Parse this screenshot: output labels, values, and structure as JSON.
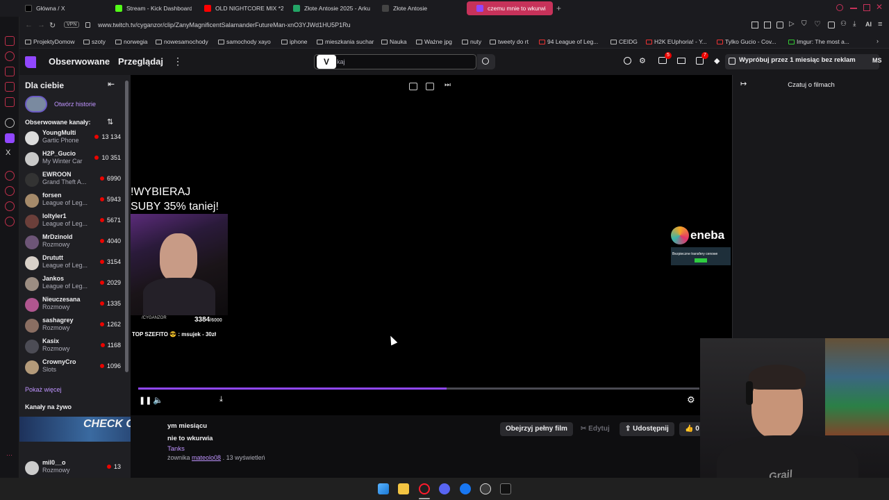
{
  "browser": {
    "tabs": [
      {
        "label": "Główna / X",
        "favicon": "x-icon",
        "active": false
      },
      {
        "label": "Stream - Kick Dashboard",
        "favicon": "kick-icon",
        "active": false
      },
      {
        "label": "OLD NIGHTCORE MIX *20",
        "favicon": "youtube-icon",
        "active": false
      },
      {
        "label": "Złote Antosie 2025 - Arku",
        "favicon": "sheets-icon",
        "active": false
      },
      {
        "label": "Złote Antosie",
        "favicon": "tab-icon",
        "active": false
      },
      {
        "label": "czemu mnie to wkurwi",
        "favicon": "twitch-icon",
        "active": true
      }
    ],
    "url": "www.twitch.tv/cyganzor/clip/ZanyMagnificentSalamanderFutureMan-xnO3YJWd1HU5P1Ru",
    "vpn_label": "VPN",
    "ai_label": "AI",
    "bookmarks": [
      "ProjektyDomow",
      "szoty",
      "norwegia",
      "nowesamochody",
      "samochody xayo",
      "iphone",
      "mieszkania suchar",
      "Nauka",
      "Ważne jpg",
      "nuty",
      "tweety do rt",
      "94 League of Leg...",
      "CEIDG",
      "H2K EUphoria! - Y...",
      "Tylko Gucio - Cov...",
      "Imgur: The most a..."
    ]
  },
  "twitch": {
    "nav": {
      "followed": "Obserwowane",
      "browse": "Przeglądaj",
      "search_placeholder": "kaj",
      "search_logo": "V",
      "promo": "Wypróbuj przez 1 miesiąc bez reklam",
      "avatar_initials": "MS",
      "badge_prime": "5",
      "badge_notif": "7"
    },
    "sidebar": {
      "title": "Dla ciebie",
      "stories": "Otwórz historie",
      "followed_header": "Obserwowane kanały:",
      "channels": [
        {
          "name": "YoungMulti",
          "game": "Gartic Phone",
          "viewers": "13 134",
          "color": "#dcdcdc"
        },
        {
          "name": "H2P_Gucio",
          "game": "My Winter Car",
          "viewers": "10 351",
          "color": "#c9c9c9"
        },
        {
          "name": "EWROON",
          "game": "Grand Theft A...",
          "viewers": "6990",
          "color": "#333333"
        },
        {
          "name": "forsen",
          "game": "League of Leg...",
          "viewers": "5943",
          "color": "#a58a6a"
        },
        {
          "name": "loltyler1",
          "game": "League of Leg...",
          "viewers": "5671",
          "color": "#6b3f3a"
        },
        {
          "name": "MrDzinold",
          "game": "Rozmowy",
          "viewers": "4040",
          "color": "#6d5577"
        },
        {
          "name": "Drututt",
          "game": "League of Leg...",
          "viewers": "3154",
          "color": "#d8d0c8"
        },
        {
          "name": "Jankos",
          "game": "League of Leg...",
          "viewers": "2029",
          "color": "#9c8d82"
        },
        {
          "name": "Nieuczesana",
          "game": "Rozmowy",
          "viewers": "1335",
          "color": "#b0568f"
        },
        {
          "name": "sashagrey",
          "game": "Rozmowy",
          "viewers": "1262",
          "color": "#8a6e62"
        },
        {
          "name": "Kasix",
          "game": "Rozmowy",
          "viewers": "1168",
          "color": "#4c4c55"
        },
        {
          "name": "CrownyCro",
          "game": "Slots",
          "viewers": "1096",
          "color": "#b39a7a"
        }
      ],
      "show_more": "Pokaż więcej",
      "live_header": "Kanały na żywo",
      "live_channel": {
        "name": "mil0__o",
        "game": "Rozmowy",
        "viewers": "13"
      },
      "overlay_text": "CHECK OUT"
    },
    "player": {
      "overlay_line1": "!WYBIERAJ",
      "overlay_line2": "SUBY 35% taniej!",
      "sub_count": "3384",
      "sub_goal": "/6000",
      "handle": "/CYGANZOR",
      "top_donor": "TOP SZEFITO 😎 : msujek - 30zł",
      "sponsor": "eneba",
      "sponsor_tagline": "Bezpieczne transfery cenowe",
      "progress_percent": 55
    },
    "chat": {
      "title": "Czatuj o filmach"
    },
    "clip": {
      "period": "ym miesiącu",
      "title": "nie to wkurwia",
      "game": "Tanks",
      "creator_prefix": "żownika",
      "creator": "mateolo08",
      "views": ". 13 wyświetleń",
      "watch_full": "Obejrzyj pełny film",
      "edit": "Edytuj",
      "share": "Udostępnij",
      "likes": "0"
    }
  },
  "webcam": {
    "shirt_text": "Grail Nightclub"
  }
}
